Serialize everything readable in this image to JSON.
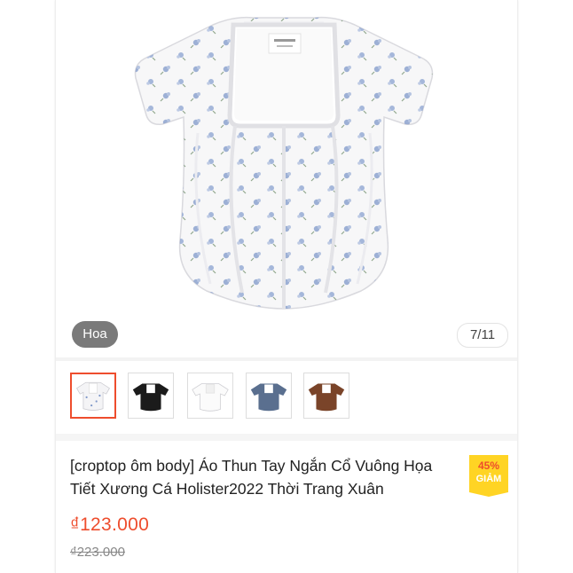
{
  "gallery": {
    "variant_label": "Hoa",
    "image_counter": "7/11"
  },
  "thumbnails": [
    {
      "name": "floral-white",
      "color": "#f6f6f6",
      "active": true
    },
    {
      "name": "black",
      "color": "#1b1b1b",
      "active": false
    },
    {
      "name": "white",
      "color": "#ffffff",
      "active": false
    },
    {
      "name": "slate-blue",
      "color": "#5a6f8f",
      "active": false
    },
    {
      "name": "brown",
      "color": "#7a4429",
      "active": false
    }
  ],
  "product": {
    "title": "[croptop ôm body] Áo Thun Tay Ngắn Cổ Vuông Họa Tiết Xương Cá Holister2022 Thời Trang Xuân",
    "price": "₫123.000",
    "original_price": "₫223.000",
    "discount_percent": "45%",
    "discount_label": "GIẢM"
  },
  "colors": {
    "accent": "#ee4d2d",
    "discount_badge": "#ffd424",
    "flower_blue": "#7f98c9"
  }
}
